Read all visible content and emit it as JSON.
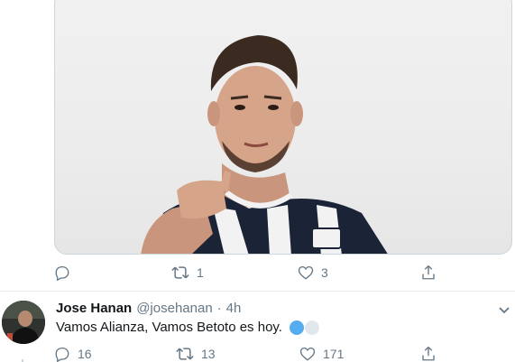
{
  "tweet1": {
    "actions": {
      "reply_count": "",
      "retweet_count": "1",
      "like_count": "3"
    }
  },
  "tweet2": {
    "author_name": "Jose Hanan",
    "author_handle": "@josehanan",
    "separator": "·",
    "time": "4h",
    "text": "Vamos Alianza, Vamos Betoto es hoy.",
    "emoji": [
      "blue-circle",
      "white-circle"
    ],
    "actions": {
      "reply_count": "16",
      "retweet_count": "13",
      "like_count": "171"
    }
  },
  "colors": {
    "action_gray": "#657786",
    "divider": "#e6ecf0",
    "blue_circle": "#55acee",
    "white_circle": "#e1e8ed"
  }
}
